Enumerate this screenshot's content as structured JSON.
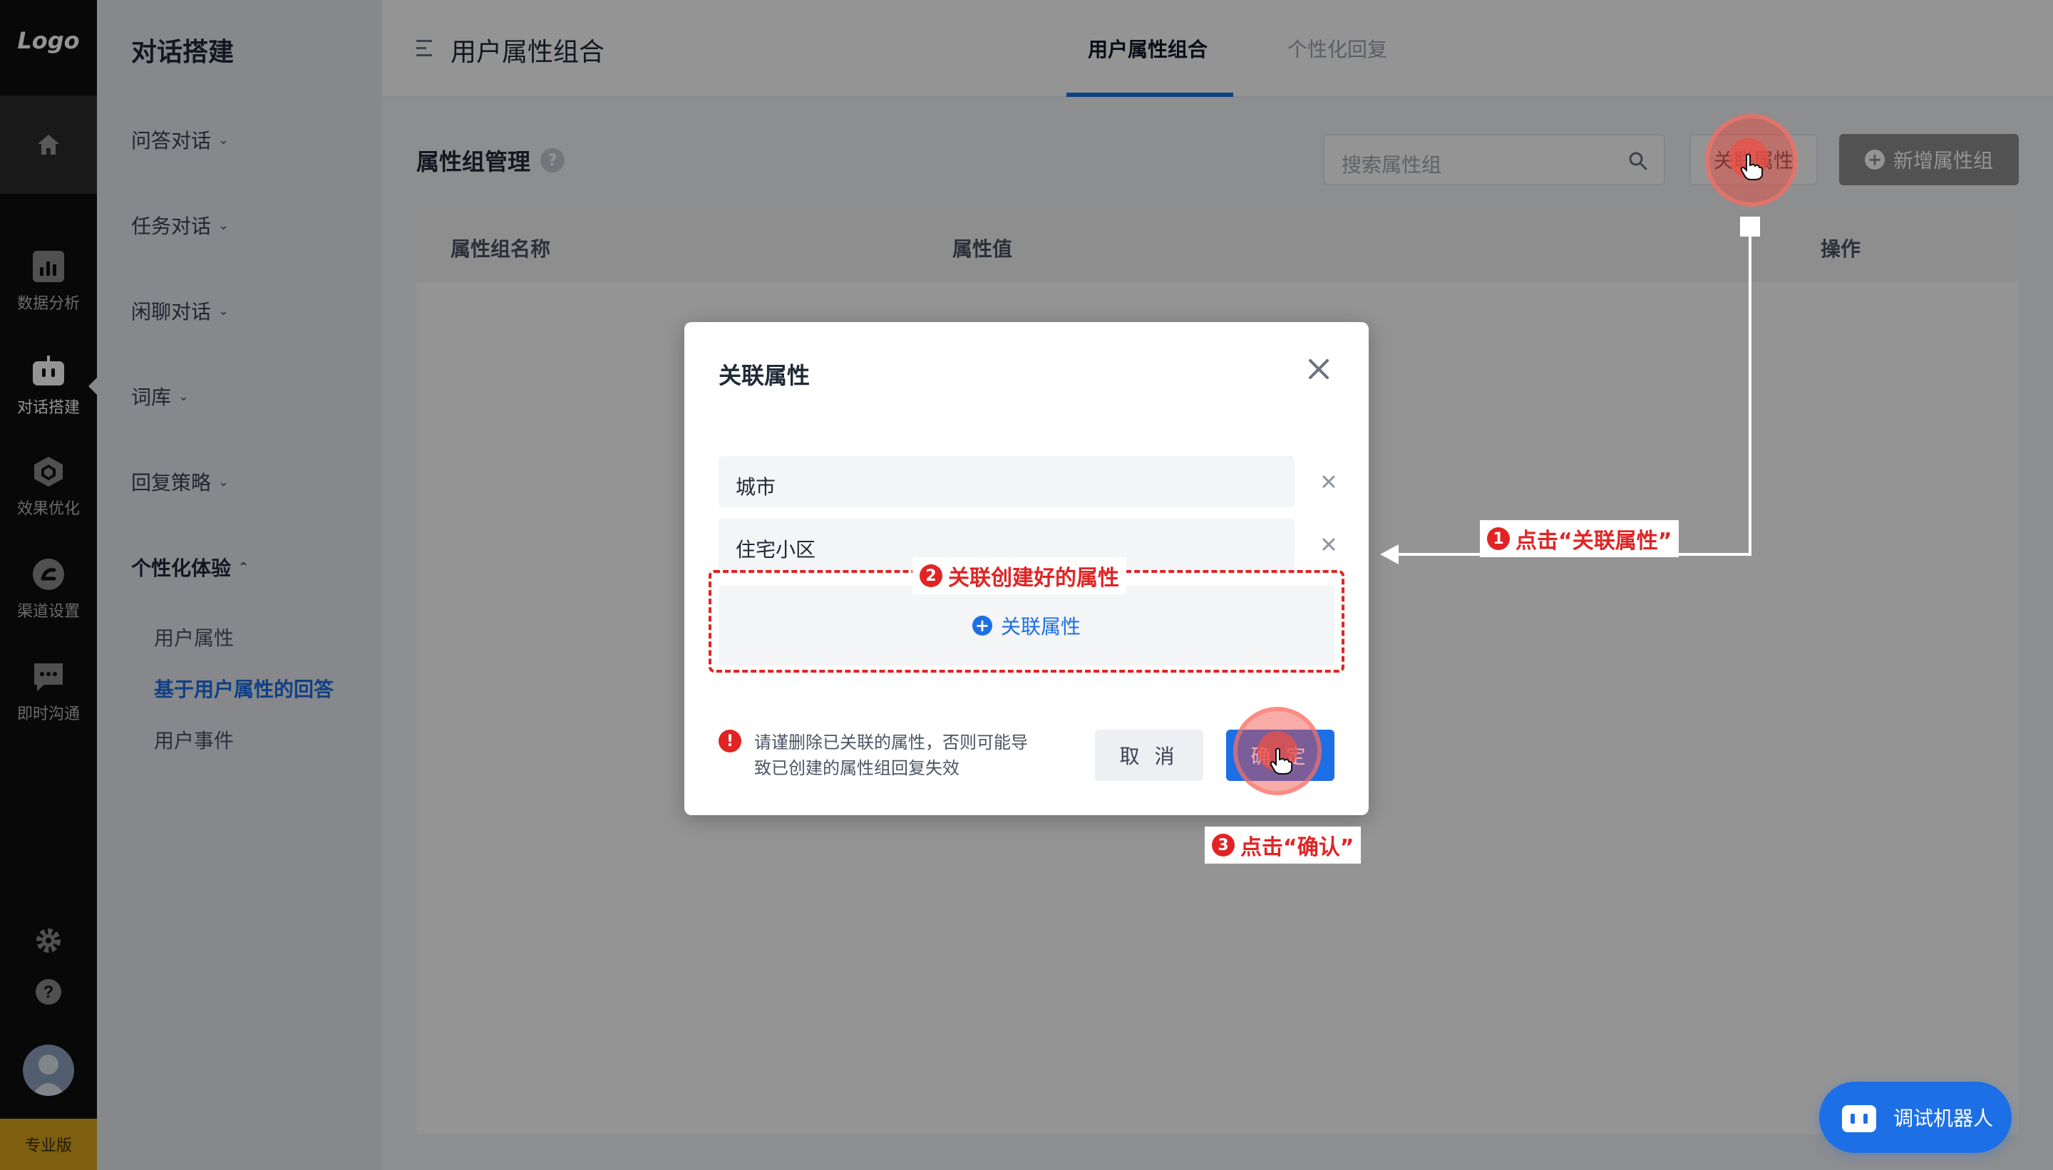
{
  "rail": {
    "logo": "Logo",
    "items": [
      {
        "label": "数据分析",
        "icon": "bar-chart-icon"
      },
      {
        "label": "对话搭建",
        "icon": "robot-icon"
      },
      {
        "label": "效果优化",
        "icon": "cube-icon"
      },
      {
        "label": "渠道设置",
        "icon": "channel-icon"
      },
      {
        "label": "即时沟通",
        "icon": "chat-icon"
      }
    ],
    "edition": "专业版"
  },
  "subnav": {
    "title": "对话搭建",
    "groups": [
      {
        "label": "问答对话"
      },
      {
        "label": "任务对话"
      },
      {
        "label": "闲聊对话"
      },
      {
        "label": "词库"
      },
      {
        "label": "回复策略"
      },
      {
        "label": "个性化体验"
      }
    ],
    "sub_items": [
      {
        "label": "用户属性"
      },
      {
        "label": "基于用户属性的回答"
      },
      {
        "label": "用户事件"
      }
    ]
  },
  "header": {
    "page_title": "用户属性组合",
    "tabs": [
      {
        "label": "用户属性组合"
      },
      {
        "label": "个性化回复"
      }
    ]
  },
  "main": {
    "section_title": "属性组管理",
    "help_glyph": "?",
    "search_placeholder": "搜索属性组",
    "link_button": "关联属性",
    "new_button": "新增属性组",
    "columns": [
      "属性组名称",
      "属性值",
      "操作"
    ]
  },
  "dialog": {
    "title": "关联属性",
    "fields": [
      {
        "value": "城市"
      },
      {
        "value": "住宅小区"
      }
    ],
    "add_label": "关联属性",
    "warning": "请谨删除已关联的属性，否则可能导致已创建的属性组回复失效",
    "warning_line1": "请谨删除已关联的属性，否则可能导",
    "warning_line2": "致已创建的属性组回复失效",
    "cancel": "取 消",
    "confirm": "确 定"
  },
  "annotations": {
    "step1": {
      "num": "1",
      "text": "点击“关联属性”"
    },
    "step2": {
      "num": "2",
      "text": "关联创建好的属性"
    },
    "step3": {
      "num": "3",
      "text": "点击“确认”"
    }
  },
  "robot_button": {
    "label": "调试机器人"
  },
  "colors": {
    "accent": "#1d6fe6",
    "annotation": "#e02424",
    "edition": "#d9a21b"
  }
}
